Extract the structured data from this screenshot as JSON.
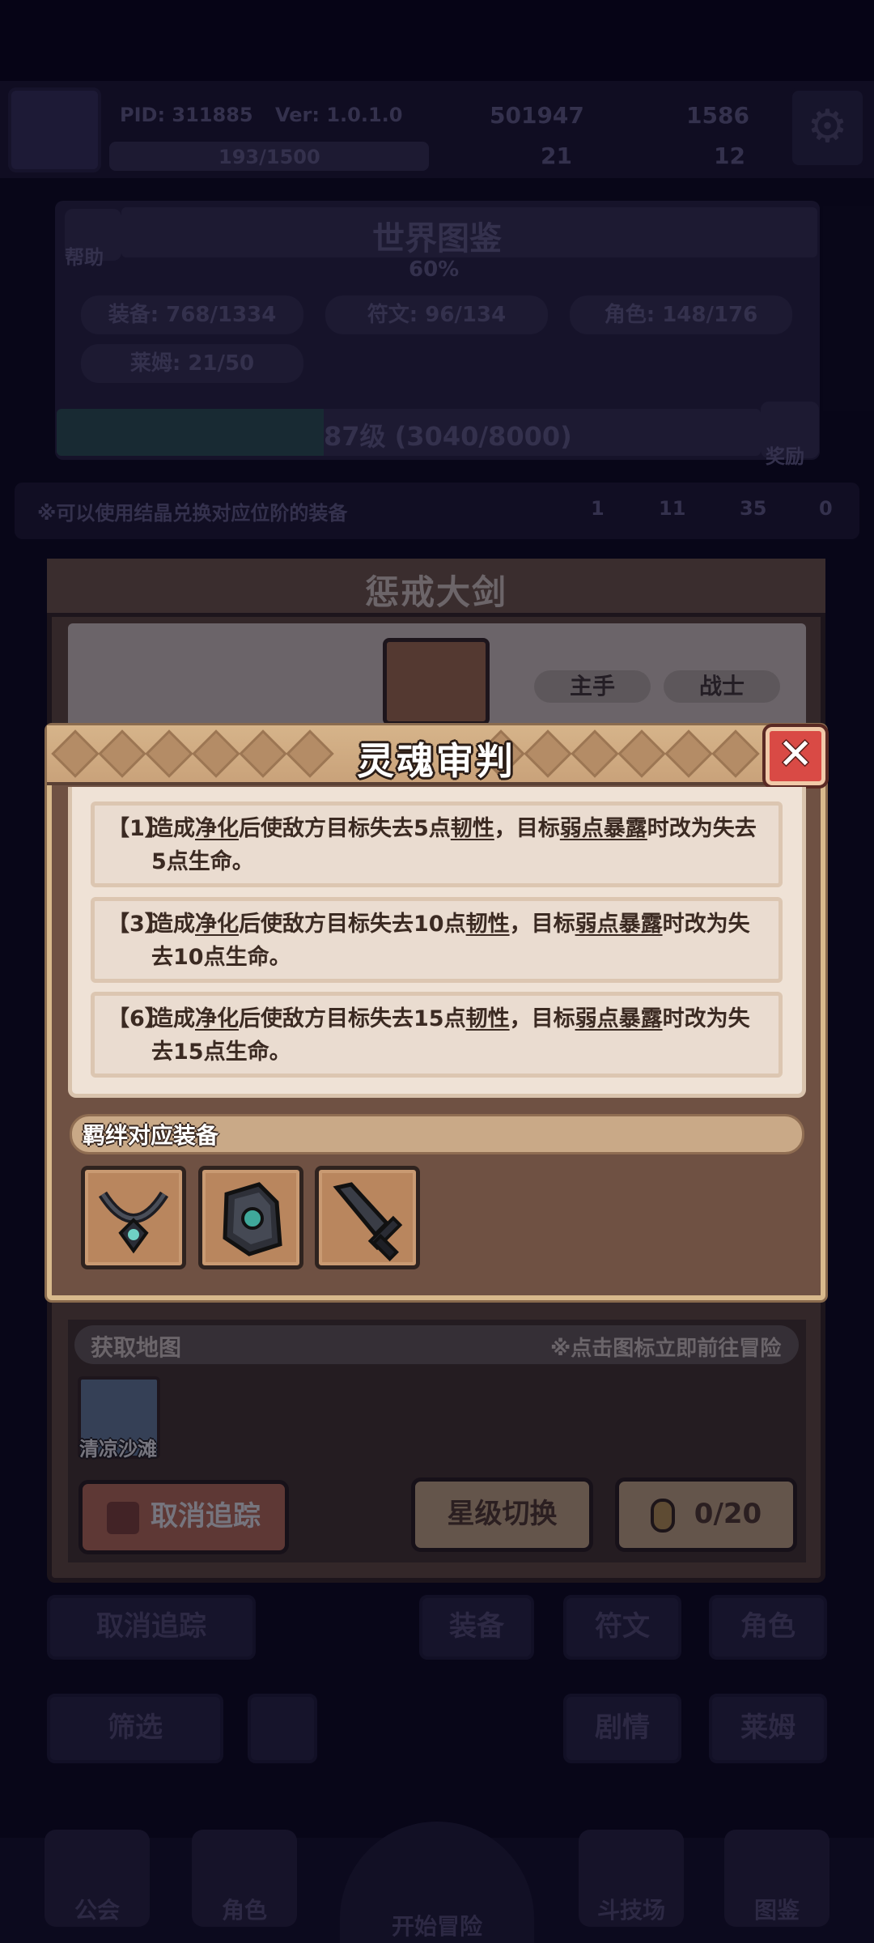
{
  "hud": {
    "pid": "PID: 311885",
    "version": "Ver: 1.0.1.0",
    "stamina": "193/1500",
    "coins": "501947",
    "gems": "1586",
    "item_a": "21",
    "item_b": "12"
  },
  "codex": {
    "help_label": "帮助",
    "title": "世界图鉴",
    "percent": "60%",
    "stats": [
      "装备: 768/1334",
      "符文: 96/134",
      "角色: 148/176",
      "莱姆: 21/50"
    ],
    "level": "87级 (3040/8000)",
    "reward_label": "奖励",
    "notice": "※可以使用结晶兑换对应位阶的装备",
    "crystals": [
      "1",
      "11",
      "35",
      "0"
    ]
  },
  "equipment": {
    "name": "惩戒大剑",
    "tags": [
      "主手",
      "战士"
    ],
    "map_section_label": "获取地图",
    "map_hint": "※点击图标立即前往冒险",
    "map_name": "清凉沙滩",
    "untrack_label": "取消追踪",
    "star_switch_label": "星级切换",
    "progress": "0/20"
  },
  "popup": {
    "title": "灵魂审判",
    "effects": [
      {
        "tier": "【1】",
        "line1": [
          "造成",
          "净化",
          "后使敌方目标失去5点",
          "韧性",
          "，目标",
          "弱点暴露",
          "时改为失去"
        ],
        "line2": "5点生命。"
      },
      {
        "tier": "【3】",
        "line1": [
          "造成",
          "净化",
          "后使敌方目标失去10点",
          "韧性",
          "，目标",
          "弱点暴露",
          "时改为失"
        ],
        "line2": "去10点生命。"
      },
      {
        "tier": "【6】",
        "line1": [
          "造成",
          "净化",
          "后使敌方目标失去15点",
          "韧性",
          "，目标",
          "弱点暴露",
          "时改为失"
        ],
        "line2": "去15点生命。"
      }
    ],
    "bond_label": "羁绊对应装备",
    "bond_items": [
      "necklace-icon",
      "gauntlet-icon",
      "greatsword-icon"
    ]
  },
  "lower": {
    "untrack_label": "取消追踪",
    "tabs": [
      "装备",
      "符文",
      "角色"
    ],
    "filter_label": "筛选",
    "sub_tabs": [
      "剧情",
      "莱姆"
    ]
  },
  "nav": {
    "items": [
      "公会",
      "角色",
      "开始冒险",
      "斗技场",
      "图鉴"
    ]
  },
  "colors": {
    "popup_frame": "#d8b98c",
    "popup_body": "#6f5143",
    "close_red": "#d94a45",
    "effect_text": "#3b2a22"
  }
}
